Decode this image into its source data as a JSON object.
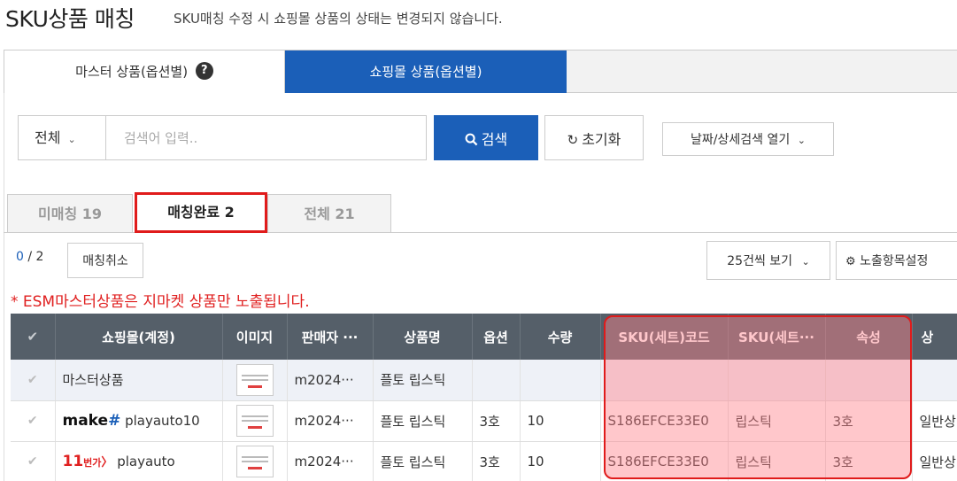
{
  "page": {
    "title": "SKU상품 매칭",
    "subtitle": "SKU매칭 수정 시 쇼핑몰 상품의 상태는 변경되지 않습니다."
  },
  "main_tabs": [
    {
      "label": "마스터 상품(옵션별)",
      "help": "?"
    },
    {
      "label": "쇼핑몰 상품(옵션별)"
    }
  ],
  "search": {
    "scope_value": "전체",
    "input_placeholder": "검색어 입력..",
    "search_label": "검색",
    "reset_label": "초기화",
    "detail_label": "날짜/상세검색 열기"
  },
  "status_tabs": [
    {
      "label": "미매칭 19"
    },
    {
      "label": "매칭완료 2"
    },
    {
      "label": "전체 21"
    }
  ],
  "toolbar": {
    "selected_count": "0",
    "separator": "/",
    "total_count": "2",
    "cancel_match_label": "매칭취소",
    "per_page_label": "25건씩 보기",
    "columns_label": "노출항목설정"
  },
  "notice": "* ESM마스터상품은 지마켓 상품만 노출됩니다.",
  "table": {
    "headers": [
      "✔",
      "쇼핑몰(계정)",
      "이미지",
      "판매자 ···",
      "상품명",
      "옵션",
      "수량",
      "SKU(세트)코드",
      "SKU(세트···",
      "속성",
      "상"
    ],
    "rows": [
      {
        "shop_logo": "",
        "shop": "마스터상품",
        "seller": "m2024···",
        "name": "플토 립스틱",
        "option": "",
        "qty": "",
        "sku_code": "",
        "sku_name": "",
        "attr": "",
        "extra": ""
      },
      {
        "shop_logo": "make#",
        "shop": "playauto10",
        "seller": "m2024···",
        "name": "플토 립스틱",
        "option": "3호",
        "qty": "10",
        "sku_code": "S186EFCE33E0",
        "sku_name": "립스틱",
        "attr": "3호",
        "extra": "일반상"
      },
      {
        "shop_logo": "11번가",
        "shop": "playauto",
        "seller": "m2024···",
        "name": "플토 립스틱",
        "option": "3호",
        "qty": "10",
        "sku_code": "S186EFCE33E0",
        "sku_name": "립스틱",
        "attr": "3호",
        "extra": "일반상"
      }
    ]
  }
}
